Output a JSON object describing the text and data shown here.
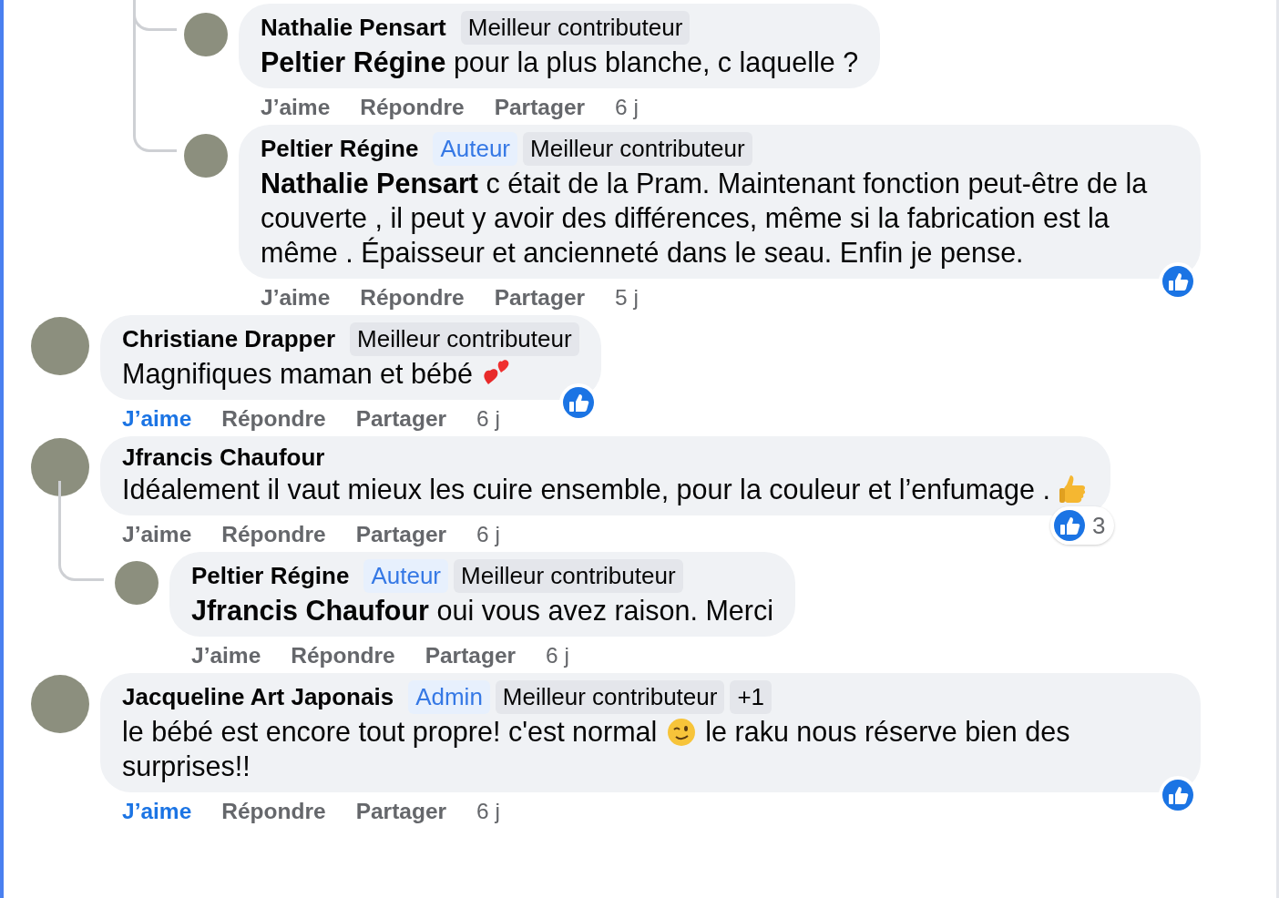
{
  "comments": [
    {
      "kind": "continuation",
      "children": [
        {
          "kind": "comment",
          "author": "Nathalie Pensart",
          "badges": [
            {
              "kind": "top",
              "label": "Meilleur contributeur"
            }
          ],
          "text": [
            {
              "kind": "text",
              "text": "**Peltier Régine** pour la plus blanche, c laquelle ?"
            }
          ],
          "reacted": false,
          "actions": {
            "like": "J’aime",
            "reply": "Répondre",
            "share": "Partager",
            "time": "6 j"
          },
          "liked": false
        },
        {
          "kind": "comment",
          "author": "Peltier Régine",
          "badges": [
            {
              "kind": "author",
              "label": "Auteur"
            },
            {
              "kind": "top",
              "label": "Meilleur contributeur"
            }
          ],
          "text": [
            {
              "kind": "text",
              "text": "**Nathalie Pensart** c était de la Pram. Maintenant fonction peut-être de la couverte , il peut y avoir des différences, même si la fabrication est la même . Épaisseur et ancienneté dans le seau. Enfin je pense."
            }
          ],
          "reacted": true,
          "actions": {
            "like": "J’aime",
            "reply": "Répondre",
            "share": "Partager",
            "time": "5 j"
          },
          "liked": false
        }
      ]
    },
    {
      "kind": "comment",
      "author": "Christiane Drapper",
      "badges": [
        {
          "kind": "top",
          "label": "Meilleur contributeur"
        }
      ],
      "text": [
        {
          "kind": "text",
          "text": "Magnifiques maman et bébé"
        },
        {
          "kind": "hearts"
        }
      ],
      "reacted": true,
      "actions": {
        "like": "J’aime",
        "reply": "Répondre",
        "share": "Partager",
        "time": "6 j"
      },
      "liked": true
    },
    {
      "kind": "comment",
      "author": "Jfrancis Chaufour",
      "text": [
        {
          "kind": "text",
          "text": "Idéalement il vaut mieux les cuire ensemble, pour la couleur et l’enfumage ."
        },
        {
          "kind": "thumb"
        }
      ],
      "reacted": true,
      "reaction_count": "3",
      "actions": {
        "like": "J’aime",
        "reply": "Répondre",
        "share": "Partager",
        "time": "6 j"
      },
      "liked": false,
      "children": [
        {
          "kind": "comment",
          "author": "Peltier Régine",
          "badges": [
            {
              "kind": "author",
              "label": "Auteur"
            },
            {
              "kind": "top",
              "label": "Meilleur contributeur"
            }
          ],
          "text": [
            {
              "kind": "text",
              "text": "**Jfrancis Chaufour** oui vous avez raison. Merci"
            }
          ],
          "reacted": false,
          "actions": {
            "like": "J’aime",
            "reply": "Répondre",
            "share": "Partager",
            "time": "6 j"
          },
          "liked": false
        }
      ]
    },
    {
      "kind": "comment",
      "author": "Jacqueline Art Japonais",
      "badges": [
        {
          "kind": "admin",
          "label": "Admin"
        },
        {
          "kind": "top",
          "label": "Meilleur contributeur"
        },
        {
          "kind": "more",
          "label": "+1"
        }
      ],
      "text": [
        {
          "kind": "text",
          "text": "le bébé est encore tout propre! c'est normal"
        },
        {
          "kind": "wink"
        },
        {
          "kind": "text",
          "text": "le raku nous réserve bien des"
        },
        {
          "kind": "text",
          "text": "surprises!!"
        }
      ],
      "reacted": true,
      "actions": {
        "like": "J’aime",
        "reply": "Répondre",
        "share": "Partager",
        "time": "6 j"
      },
      "liked": true
    }
  ]
}
